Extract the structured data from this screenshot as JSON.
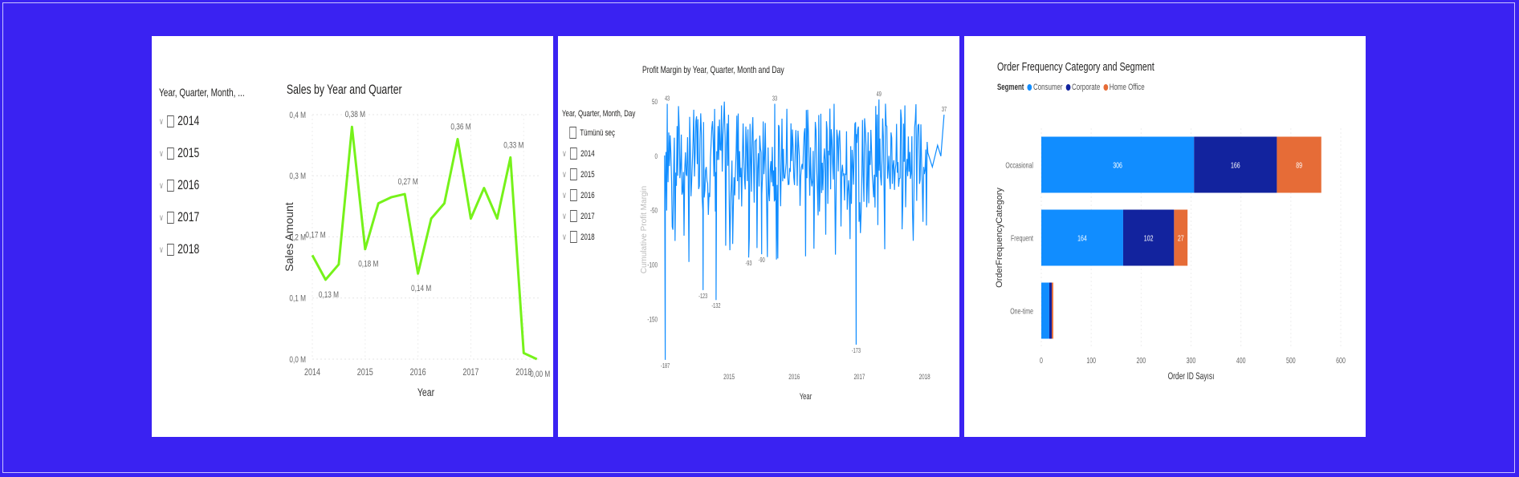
{
  "colors": {
    "background": "#3a22f2",
    "line_green": "#76f21a",
    "line_blue": "#118dff",
    "consumer": "#118dff",
    "corporate": "#12239e",
    "home_office": "#e66c37"
  },
  "slicer1": {
    "title": "Year, Quarter, Month, ...",
    "items": [
      "2014",
      "2015",
      "2016",
      "2017",
      "2018"
    ]
  },
  "slicer2": {
    "title": "Year, Quarter, Month, Day",
    "items": [
      "Tümünü seç",
      "2014",
      "2015",
      "2016",
      "2017",
      "2018"
    ]
  },
  "chart_data": [
    {
      "type": "line",
      "title": "Sales by Year and Quarter",
      "xlabel": "Year",
      "ylabel": "Sales Amount",
      "x_ticks": [
        "2014",
        "2015",
        "2016",
        "2017",
        "2018"
      ],
      "y_ticks": [
        "0,0 M",
        "0,1 M",
        "0,2 M",
        "0,3 M",
        "0,4 M"
      ],
      "ylim": [
        0,
        0.4
      ],
      "xlim": [
        2014,
        2018.3
      ],
      "grid": true,
      "x": [
        2014.0,
        2014.25,
        2014.5,
        2014.75,
        2015.0,
        2015.25,
        2015.5,
        2015.75,
        2016.0,
        2016.25,
        2016.5,
        2016.75,
        2017.0,
        2017.25,
        2017.5,
        2017.75,
        2018.0,
        2018.25
      ],
      "y": [
        0.17,
        0.13,
        0.155,
        0.38,
        0.18,
        0.255,
        0.265,
        0.27,
        0.14,
        0.23,
        0.255,
        0.36,
        0.23,
        0.28,
        0.23,
        0.33,
        0.01,
        0.0
      ],
      "data_labels": [
        {
          "x": 2014.0,
          "y": 0.17,
          "text": "0,17 M"
        },
        {
          "x": 2014.25,
          "y": 0.13,
          "text": "0,13 M"
        },
        {
          "x": 2014.75,
          "y": 0.38,
          "text": "0,38 M"
        },
        {
          "x": 2015.0,
          "y": 0.18,
          "text": "0,18 M"
        },
        {
          "x": 2015.75,
          "y": 0.27,
          "text": "0,27 M"
        },
        {
          "x": 2016.0,
          "y": 0.14,
          "text": "0,14 M"
        },
        {
          "x": 2016.75,
          "y": 0.36,
          "text": "0,36 M"
        },
        {
          "x": 2017.75,
          "y": 0.33,
          "text": "0,33 M"
        },
        {
          "x": 2018.25,
          "y": 0.0,
          "text": "0,00 M"
        }
      ]
    },
    {
      "type": "line",
      "title": "Profit Margin by Year, Quarter, Month and Day",
      "xlabel": "Year",
      "ylabel": "Cumulative Profit Margin",
      "x_ticks": [
        "2015",
        "2016",
        "2017",
        "2018"
      ],
      "y_ticks": [
        "-150",
        "-100",
        "-50",
        "0",
        "50"
      ],
      "ylim": [
        -190,
        55
      ],
      "xlim": [
        2014.0,
        2018.35
      ],
      "seed": 7,
      "base_series": [
        5,
        -20,
        30,
        -40,
        10,
        -15,
        25,
        -30,
        12,
        -8,
        20,
        -35,
        15,
        -22
      ],
      "spikes": [
        {
          "x": 2014.02,
          "y": -187,
          "text": "-187"
        },
        {
          "x": 2014.05,
          "y": 48,
          "text": "43"
        },
        {
          "x": 2014.6,
          "y": -123,
          "text": "-123"
        },
        {
          "x": 2014.8,
          "y": -132,
          "text": "-132"
        },
        {
          "x": 2015.3,
          "y": -93,
          "text": "-93"
        },
        {
          "x": 2015.5,
          "y": -90,
          "text": "-90"
        },
        {
          "x": 2015.7,
          "y": 48,
          "text": "33"
        },
        {
          "x": 2016.95,
          "y": -173,
          "text": "-173"
        },
        {
          "x": 2017.3,
          "y": 52,
          "text": "49"
        },
        {
          "x": 2018.3,
          "y": 38,
          "text": "37"
        }
      ]
    },
    {
      "type": "bar",
      "orientation": "horizontal",
      "stacked": true,
      "title": "Order Frequency Category and Segment",
      "xlabel": "Order ID Sayısı",
      "ylabel": "OrderFrequencyCategory",
      "legend_title": "Segment",
      "legend_position": "top-left",
      "categories": [
        "Occasional",
        "Frequent",
        "One-time"
      ],
      "series": [
        {
          "name": "Consumer",
          "values": [
            306,
            164,
            16
          ]
        },
        {
          "name": "Corporate",
          "values": [
            166,
            102,
            5
          ]
        },
        {
          "name": "Home Office",
          "values": [
            89,
            27,
            3
          ]
        }
      ],
      "data_labels": [
        [
          "306",
          "166",
          "89"
        ],
        [
          "164",
          "102",
          "27"
        ],
        [
          "",
          "",
          ""
        ]
      ],
      "x_ticks": [
        "0",
        "100",
        "200",
        "300",
        "400",
        "500",
        "600"
      ],
      "xlim": [
        0,
        600
      ]
    }
  ]
}
